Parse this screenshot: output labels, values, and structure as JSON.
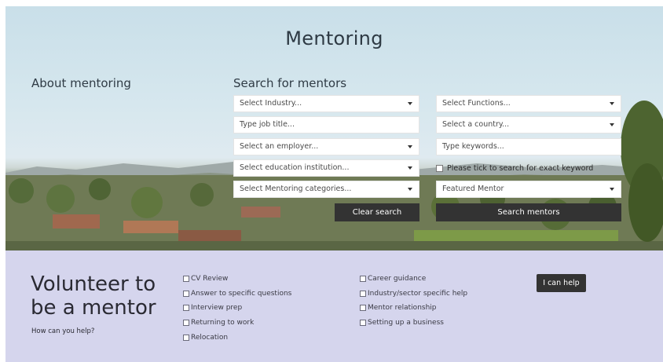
{
  "hero": {
    "title": "Mentoring",
    "about_label": "About mentoring",
    "search_heading": "Search for mentors"
  },
  "filters": {
    "industry": "Select Industry...",
    "job_title_placeholder": "Type job title...",
    "employer": "Select an employer...",
    "education": "Select education institution...",
    "categories": "Select Mentoring categories...",
    "functions": "Select Functions...",
    "country": "Select a country...",
    "keywords_placeholder": "Type keywords...",
    "exact_keyword_label": "Please tick to search for exact keyword",
    "featured": "Featured Mentor"
  },
  "buttons": {
    "clear_search": "Clear search",
    "search_mentors": "Search mentors",
    "i_can_help": "I can help"
  },
  "volunteer": {
    "title_line1": "Volunteer to",
    "title_line2": "be a mentor",
    "subtitle": "How can you help?",
    "options_col1": [
      "CV Review",
      "Answer to specific questions",
      "Interview prep",
      "Returning to work",
      "Relocation"
    ],
    "options_col2": [
      "Career guidance",
      "Industry/sector specific help",
      "Mentor relationship",
      "Setting up a business"
    ]
  },
  "colors": {
    "band_bg": "#d5d5ed",
    "button_dark": "#333333"
  }
}
